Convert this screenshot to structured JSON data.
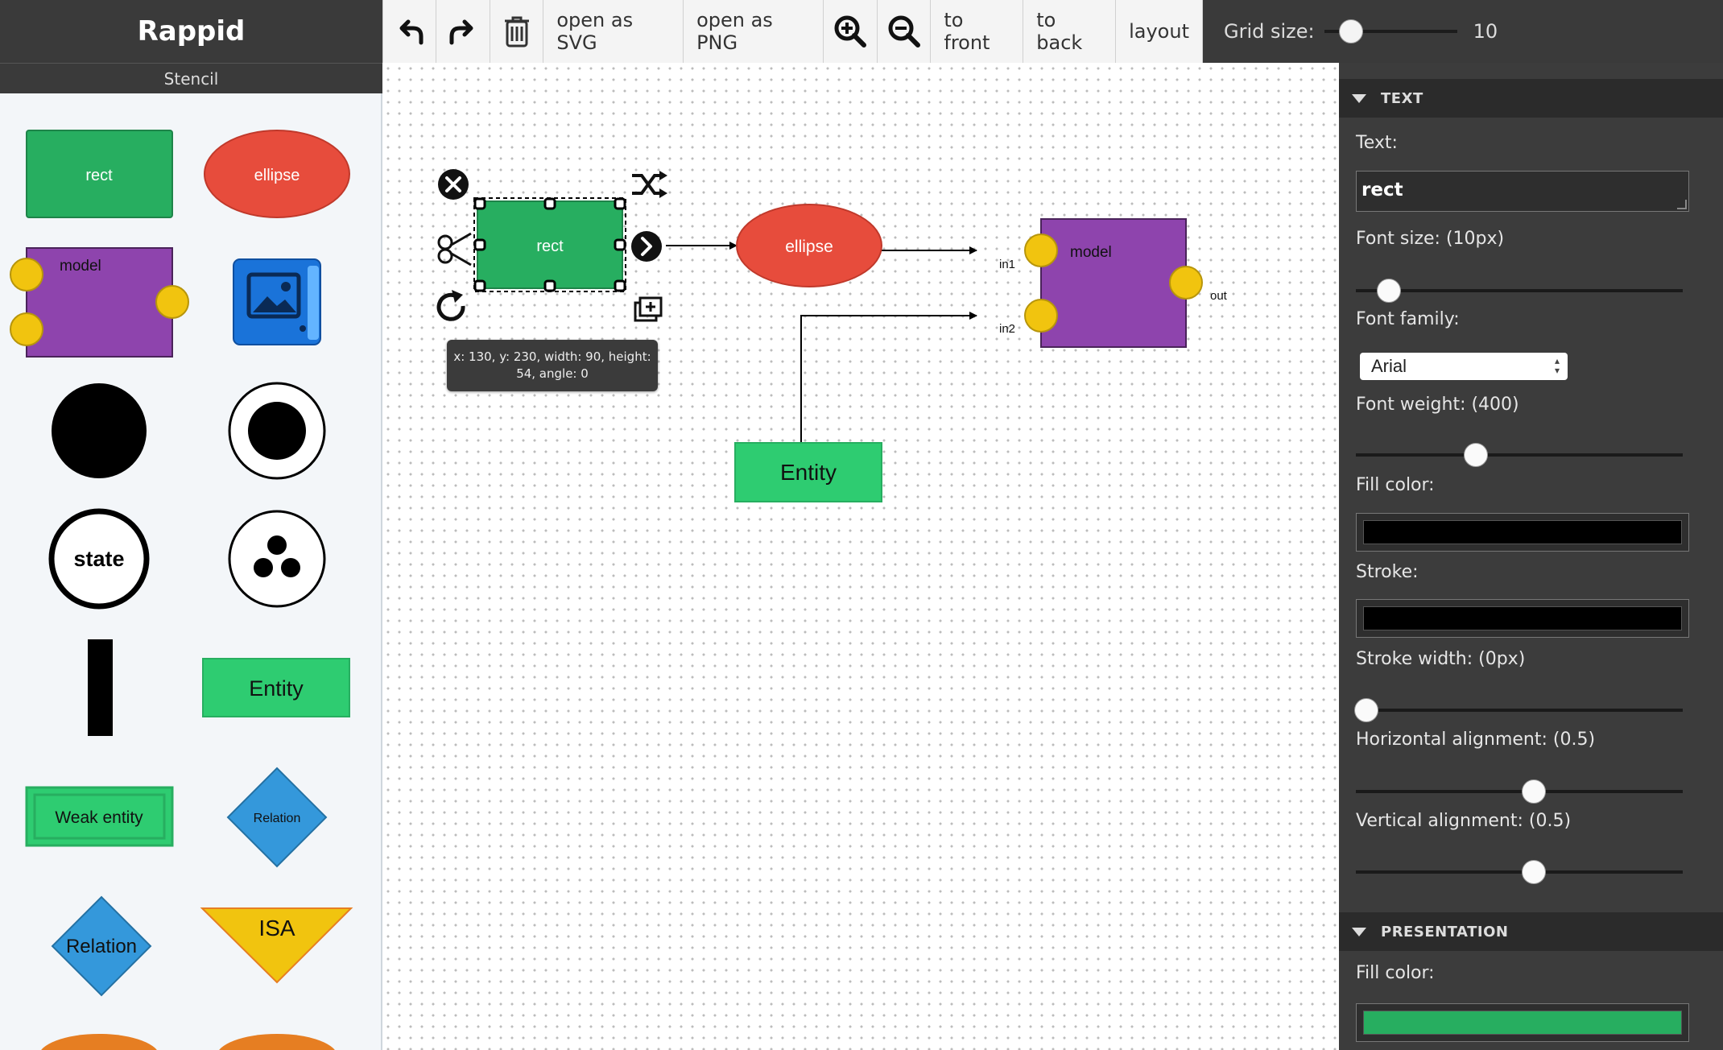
{
  "app": {
    "title": "Rappid"
  },
  "toolbar": {
    "undo_icon": "undo-arrow-icon",
    "redo_icon": "redo-arrow-icon",
    "trash_icon": "trash-icon",
    "open_svg": "open as SVG",
    "open_png": "open as PNG",
    "zoom_in_icon": "zoom-in-icon",
    "zoom_out_icon": "zoom-out-icon",
    "to_front": "to front",
    "to_back": "to back",
    "layout": "layout",
    "grid_label": "Grid size:",
    "grid_value": "10",
    "grid_slider_value": 10
  },
  "stencil": {
    "title": "Stencil",
    "items": {
      "rect": "rect",
      "ellipse": "ellipse",
      "model": "model",
      "state": "state",
      "entity": "Entity",
      "weak_entity": "Weak entity",
      "relation_small": "Relation",
      "relation": "Relation",
      "isa": "ISA"
    }
  },
  "paper": {
    "rect_label": "rect",
    "ellipse_label": "ellipse",
    "model_label": "model",
    "port_in1": "in1",
    "port_in2": "in2",
    "port_out": "out",
    "entity_label": "Entity",
    "tooltip_line1": "x: 130, y: 230, width: 90, height:",
    "tooltip_line2": "54, angle: 0"
  },
  "inspector": {
    "text_section": "TEXT",
    "text_label": "Text:",
    "text_value": "rect",
    "font_size_label": "Font size: (10px)",
    "font_size_value": 10,
    "font_family_label": "Font family:",
    "font_family_value": "Arial",
    "font_weight_label": "Font weight: (400)",
    "font_weight_value": 400,
    "fill_color_label": "Fill color:",
    "fill_color_value": "#000000",
    "stroke_label": "Stroke:",
    "stroke_value": "#000000",
    "stroke_width_label": "Stroke width: (0px)",
    "stroke_width_value": 0,
    "h_align_label": "Horizontal alignment: (0.5)",
    "h_align_value": 0.5,
    "v_align_label": "Vertical alignment: (0.5)",
    "v_align_value": 0.5,
    "presentation_section": "PRESENTATION",
    "presentation_fill_label": "Fill color:",
    "presentation_fill_value": "#27ae60"
  },
  "colors": {
    "green": "#27ae60",
    "entity_green": "#2ecc71",
    "red": "#e74c3c",
    "purple": "#8e44ad",
    "port_yellow": "#f1c40f",
    "blue": "#3498db",
    "isa_yellow": "#f1c40f",
    "orange": "#e67e22"
  }
}
